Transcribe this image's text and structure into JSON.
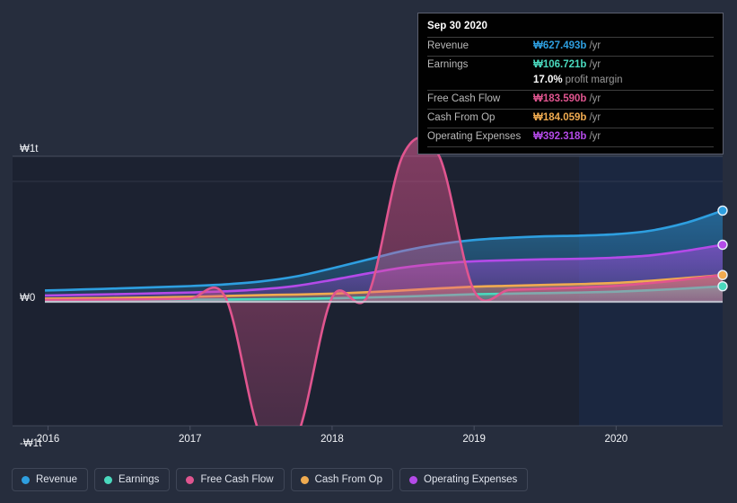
{
  "chart_data": {
    "type": "area",
    "title": "",
    "xlabel": "",
    "ylabel": "",
    "currency_symbol": "₩",
    "x_tick_labels": [
      "2016",
      "2017",
      "2018",
      "2019",
      "2020"
    ],
    "y_tick_labels": [
      "₩1t",
      "₩0",
      "-₩1t"
    ],
    "ylim": [
      -1.15,
      1.15
    ],
    "y_unit": "trillion KRW",
    "grid": true,
    "legend_position": "bottom-left",
    "x": [
      2015.75,
      2016.0,
      2016.25,
      2016.5,
      2016.75,
      2017.0,
      2017.25,
      2017.5,
      2017.75,
      2018.0,
      2018.25,
      2018.5,
      2018.75,
      2019.0,
      2019.25,
      2019.5,
      2019.75,
      2020.0,
      2020.25,
      2020.5,
      2020.75
    ],
    "series": [
      {
        "name": "Revenue",
        "color": "#2e9fe0",
        "values": [
          0.072,
          0.078,
          0.085,
          0.092,
          0.1,
          0.108,
          0.12,
          0.14,
          0.175,
          0.23,
          0.29,
          0.35,
          0.395,
          0.425,
          0.44,
          0.45,
          0.455,
          0.465,
          0.49,
          0.545,
          0.627
        ]
      },
      {
        "name": "Earnings",
        "color": "#4ad9be",
        "values": [
          0.005,
          0.006,
          0.008,
          0.01,
          0.012,
          0.014,
          0.016,
          0.018,
          0.02,
          0.024,
          0.03,
          0.036,
          0.044,
          0.052,
          0.056,
          0.06,
          0.064,
          0.07,
          0.08,
          0.092,
          0.107
        ]
      },
      {
        "name": "Free Cash Flow",
        "color": "#e0558f",
        "values": [
          0.012,
          0.013,
          0.014,
          0.016,
          0.018,
          0.022,
          0.028,
          -0.93,
          -0.93,
          0.03,
          0.04,
          1.01,
          1.01,
          0.075,
          0.082,
          0.09,
          0.098,
          0.11,
          0.13,
          0.155,
          0.184
        ]
      },
      {
        "name": "Cash From Op",
        "color": "#f0ab50",
        "values": [
          0.02,
          0.022,
          0.024,
          0.027,
          0.03,
          0.034,
          0.04,
          0.046,
          0.05,
          0.056,
          0.066,
          0.078,
          0.092,
          0.104,
          0.11,
          0.116,
          0.122,
          0.13,
          0.145,
          0.164,
          0.184
        ]
      },
      {
        "name": "Operating Expenses",
        "color": "#b44ae8",
        "values": [
          0.04,
          0.044,
          0.048,
          0.053,
          0.058,
          0.064,
          0.072,
          0.086,
          0.11,
          0.15,
          0.195,
          0.235,
          0.262,
          0.278,
          0.286,
          0.292,
          0.296,
          0.304,
          0.32,
          0.352,
          0.392
        ]
      }
    ]
  },
  "tooltip": {
    "date": "Sep 30 2020",
    "rows": [
      {
        "label": "Revenue",
        "value": "₩627.493b",
        "unit": "/yr",
        "color": "#2e9fe0"
      },
      {
        "label": "Earnings",
        "value": "₩106.721b",
        "unit": "/yr",
        "color": "#4ad9be"
      },
      {
        "label": "Free Cash Flow",
        "value": "₩183.590b",
        "unit": "/yr",
        "color": "#e0558f"
      },
      {
        "label": "Cash From Op",
        "value": "₩184.059b",
        "unit": "/yr",
        "color": "#f0ab50"
      },
      {
        "label": "Operating Expenses",
        "value": "₩392.318b",
        "unit": "/yr",
        "color": "#b44ae8"
      }
    ],
    "profit_margin_value": "17.0%",
    "profit_margin_label": "profit margin"
  },
  "legend": {
    "items": [
      {
        "label": "Revenue",
        "color": "#2e9fe0"
      },
      {
        "label": "Earnings",
        "color": "#4ad9be"
      },
      {
        "label": "Free Cash Flow",
        "color": "#e0558f"
      },
      {
        "label": "Cash From Op",
        "color": "#f0ab50"
      },
      {
        "label": "Operating Expenses",
        "color": "#b44ae8"
      }
    ]
  },
  "theme": {
    "background": "#262d3d",
    "plot_background": "#1c2231",
    "highlight_band_background": "#1b2740",
    "gridline_color": "#4a5162",
    "zero_line_color": "#c9ced8",
    "axis_label_color": "#f2f4f8"
  }
}
